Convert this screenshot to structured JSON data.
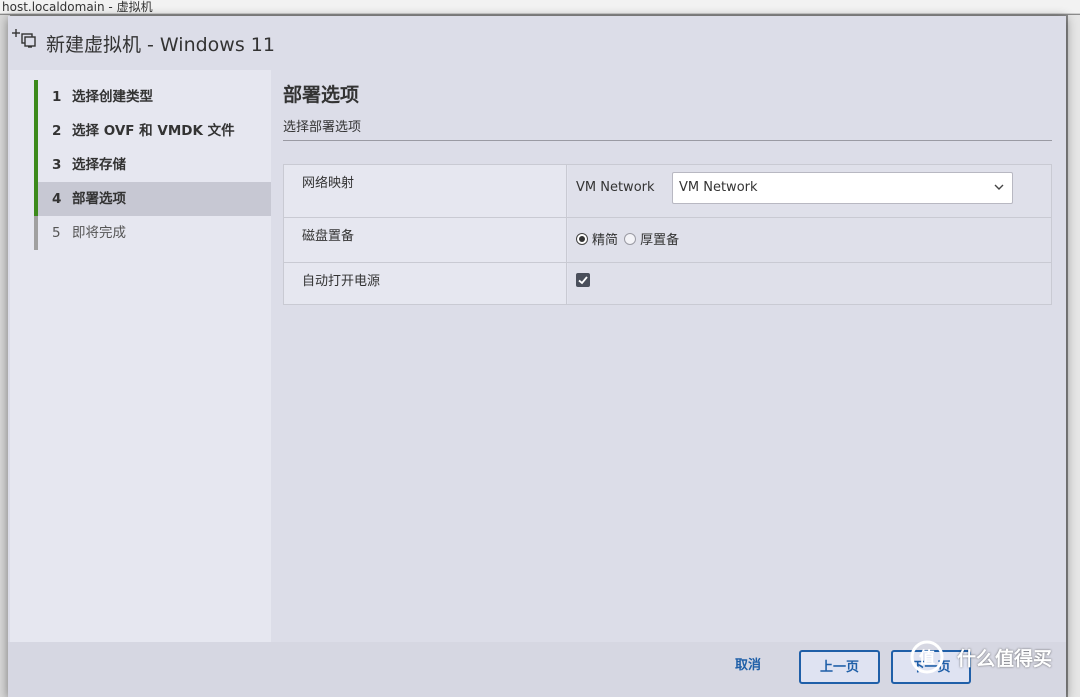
{
  "background": {
    "window_title": "host.localdomain - 虚拟机"
  },
  "dialog": {
    "title": "新建虚拟机 - Windows 11",
    "title_icon": "vm-add-icon"
  },
  "steps": [
    {
      "number": "1",
      "label": "选择创建类型",
      "state": "done"
    },
    {
      "number": "2",
      "label": "选择 OVF 和 VMDK 文件",
      "state": "done"
    },
    {
      "number": "3",
      "label": "选择存储",
      "state": "done"
    },
    {
      "number": "4",
      "label": "部署选项",
      "state": "active"
    },
    {
      "number": "5",
      "label": "即将完成",
      "state": "future"
    }
  ],
  "content": {
    "title": "部署选项",
    "subtitle": "选择部署选项",
    "options": {
      "network": {
        "label": "网络映射",
        "source": "VM Network",
        "selected": "VM Network"
      },
      "disk": {
        "label": "磁盘置备",
        "choices": [
          {
            "label": "精简",
            "selected": true
          },
          {
            "label": "厚置备",
            "selected": false
          }
        ]
      },
      "power": {
        "label": "自动打开电源",
        "checked": true
      }
    }
  },
  "footer": {
    "cancel": "取消",
    "prev": "上一页",
    "next": "下一页"
  },
  "watermark": {
    "text": "什么值得买"
  },
  "colors": {
    "accent": "#1f5fa8",
    "step_done": "#3c8a1b",
    "step_active_bg": "#c7c8d3",
    "dialog_bg": "#dcdde8"
  }
}
